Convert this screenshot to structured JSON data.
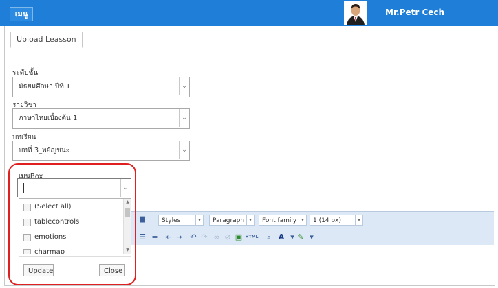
{
  "header": {
    "menu_label": "เมนู",
    "user_name": "Mr.Petr Cech"
  },
  "tabs": [
    {
      "label": "Upload Leasson"
    }
  ],
  "form": {
    "level_label": "ระดับชั้น",
    "level_value": "มัธยมศึกษา ปีที่ 1",
    "subject_label": "รายวิชา",
    "subject_value": "ภาษาไทยเบื้องต้น 1",
    "lesson_label": "บทเรียน",
    "lesson_value": "บทที่ 3_พยัญชนะ",
    "mybox_label": "เมนูBox"
  },
  "mybox_dropdown": {
    "items": [
      {
        "label": "(Select all)"
      },
      {
        "label": "tablecontrols"
      },
      {
        "label": "emotions"
      },
      {
        "label": "charmap"
      }
    ],
    "update_label": "Update",
    "close_label": "Close"
  },
  "editor_toolbar": {
    "styles": "Styles",
    "paragraph": "Paragraph",
    "font_family": "Font family",
    "font_size": "1 (14 px)",
    "html_icon_text": "HTML"
  },
  "colors": {
    "header_bg": "#1f7ed8",
    "highlight": "#e02020",
    "toolbar_bg": "#dde8f6"
  }
}
